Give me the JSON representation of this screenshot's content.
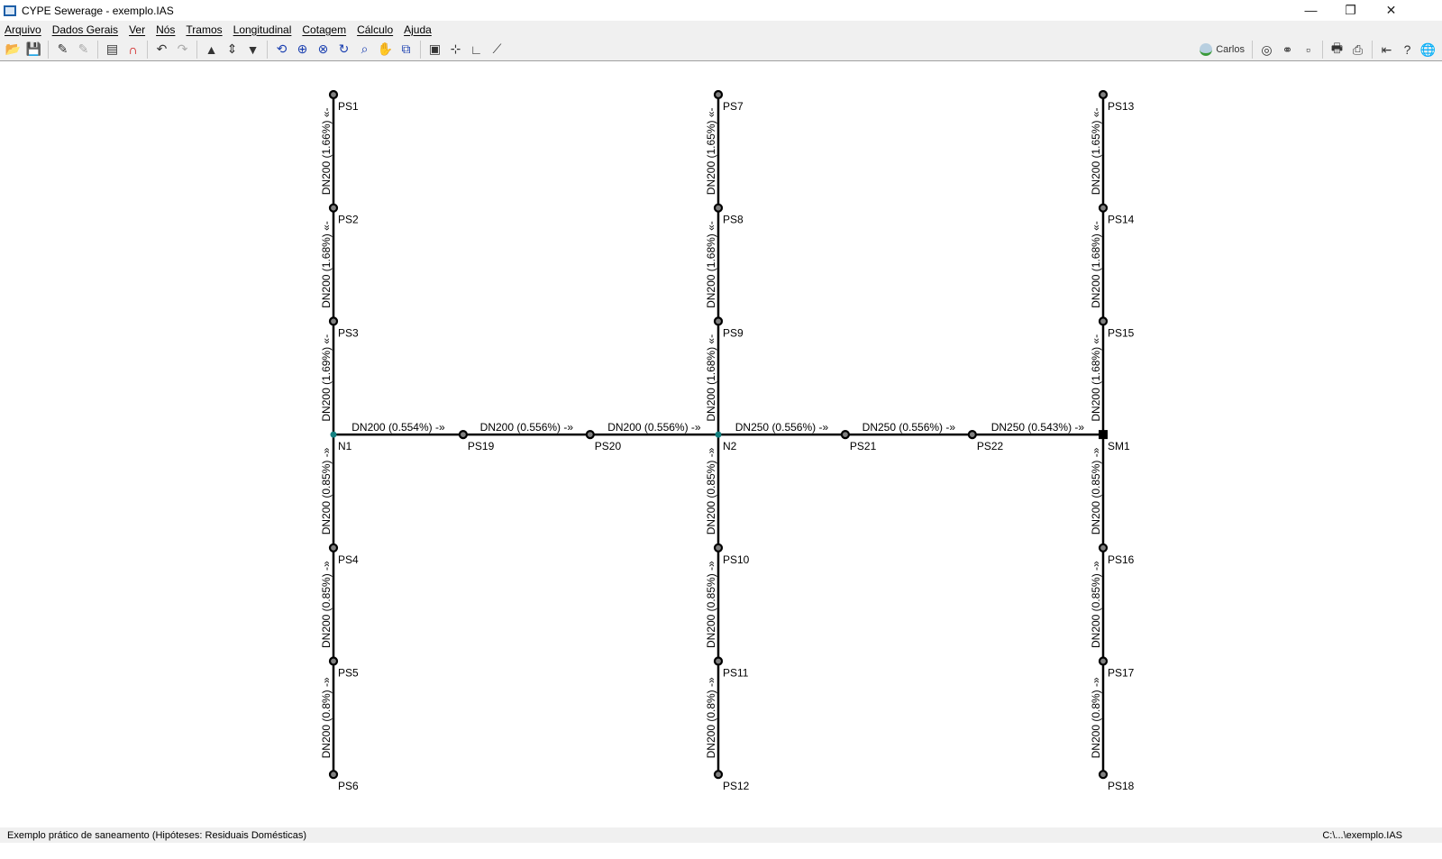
{
  "window": {
    "title": "CYPE Sewerage - exemplo.IAS",
    "minimize": "—",
    "maximize": "❐",
    "close": "✕"
  },
  "menu": [
    "Arquivo",
    "Dados Gerais",
    "Ver",
    "Nós",
    "Tramos",
    "Longitudinal",
    "Cotagem",
    "Cálculo",
    "Ajuda"
  ],
  "toolbar": {
    "left": [
      [
        "open-icon",
        "📂"
      ],
      [
        "save-icon",
        "💾"
      ],
      "|",
      [
        "wizard-icon",
        "✎"
      ],
      [
        "wizard-disabled-icon",
        "✎"
      ],
      "|",
      [
        "dxf-dwg-icon",
        "▤"
      ],
      [
        "magnet-icon",
        "∩"
      ],
      "|",
      [
        "undo-icon",
        "↶"
      ],
      [
        "redo-icon",
        "↷"
      ],
      "|",
      [
        "move-up-icon",
        "▲"
      ],
      [
        "move-updown-icon",
        "⇕"
      ],
      [
        "move-down-icon",
        "▼"
      ],
      "|",
      [
        "zoom-previous-icon",
        "⟲"
      ],
      [
        "zoom-all-icon",
        "⊕"
      ],
      [
        "zoom-x2-icon",
        "⊗"
      ],
      [
        "redraw-icon",
        "↻"
      ],
      [
        "zoom-window-icon",
        "⌕"
      ],
      [
        "pan-hand-icon",
        "✋"
      ],
      [
        "window-icon",
        "⧉"
      ],
      "|",
      [
        "binoculars-icon",
        "▣"
      ],
      [
        "axes-icon",
        "⊹"
      ],
      [
        "angle-icon",
        "∟"
      ],
      [
        "measure-icon",
        "⟋"
      ]
    ],
    "right": [
      [
        "help-green-icon",
        "◎"
      ],
      [
        "share-icon",
        "⚭"
      ],
      [
        "cube-icon",
        "▫"
      ],
      "|",
      [
        "print-icon",
        "🖶"
      ],
      [
        "print-preview-icon",
        "⎙"
      ],
      "|",
      [
        "exit-icon",
        "⇤"
      ],
      [
        "help-icon",
        "?"
      ],
      [
        "web-icon",
        "🌐"
      ]
    ],
    "user": "Carlos"
  },
  "status": {
    "left": "Exemplo prático de saneamento (Hipóteses: Residuais Domésticas)",
    "right": "C:\\...\\exemplo.IAS"
  },
  "network": {
    "nodes": [
      {
        "id": "PS1",
        "col": 0,
        "row": 0
      },
      {
        "id": "PS2",
        "col": 0,
        "row": 1
      },
      {
        "id": "PS3",
        "col": 0,
        "row": 2
      },
      {
        "id": "N1",
        "col": 0,
        "row": 3,
        "type": "junction"
      },
      {
        "id": "PS4",
        "col": 0,
        "row": 4
      },
      {
        "id": "PS5",
        "col": 0,
        "row": 5
      },
      {
        "id": "PS6",
        "col": 0,
        "row": 6
      },
      {
        "id": "PS19",
        "col": 0.337,
        "row": 3
      },
      {
        "id": "PS20",
        "col": 0.667,
        "row": 3
      },
      {
        "id": "PS7",
        "col": 1,
        "row": 0
      },
      {
        "id": "PS8",
        "col": 1,
        "row": 1
      },
      {
        "id": "PS9",
        "col": 1,
        "row": 2
      },
      {
        "id": "N2",
        "col": 1,
        "row": 3,
        "type": "junction"
      },
      {
        "id": "PS10",
        "col": 1,
        "row": 4
      },
      {
        "id": "PS11",
        "col": 1,
        "row": 5
      },
      {
        "id": "PS12",
        "col": 1,
        "row": 6
      },
      {
        "id": "PS21",
        "col": 1.33,
        "row": 3
      },
      {
        "id": "PS22",
        "col": 1.66,
        "row": 3
      },
      {
        "id": "PS13",
        "col": 2,
        "row": 0
      },
      {
        "id": "PS14",
        "col": 2,
        "row": 1
      },
      {
        "id": "PS15",
        "col": 2,
        "row": 2
      },
      {
        "id": "SM1",
        "col": 2,
        "row": 3,
        "type": "outfall"
      },
      {
        "id": "PS16",
        "col": 2,
        "row": 4
      },
      {
        "id": "PS17",
        "col": 2,
        "row": 5
      },
      {
        "id": "PS18",
        "col": 2,
        "row": 6
      }
    ],
    "pipes": [
      {
        "from": "PS1",
        "to": "PS2",
        "label": "DN200 (1.66%) «-"
      },
      {
        "from": "PS2",
        "to": "PS3",
        "label": "DN200 (1.68%) «-"
      },
      {
        "from": "PS3",
        "to": "N1",
        "label": "DN200 (1.69%) «-"
      },
      {
        "from": "N1",
        "to": "PS4",
        "label": "DN200 (0.85%) -»"
      },
      {
        "from": "PS4",
        "to": "PS5",
        "label": "DN200 (0.85%) -»"
      },
      {
        "from": "PS5",
        "to": "PS6",
        "label": "DN200 (0.8%) -»"
      },
      {
        "from": "PS7",
        "to": "PS8",
        "label": "DN200 (1.65%) «-"
      },
      {
        "from": "PS8",
        "to": "PS9",
        "label": "DN200 (1.68%) «-"
      },
      {
        "from": "PS9",
        "to": "N2",
        "label": "DN200 (1.68%) «-"
      },
      {
        "from": "N2",
        "to": "PS10",
        "label": "DN200 (0.85%) -»"
      },
      {
        "from": "PS10",
        "to": "PS11",
        "label": "DN200 (0.85%) -»"
      },
      {
        "from": "PS11",
        "to": "PS12",
        "label": "DN200 (0.8%) -»"
      },
      {
        "from": "PS13",
        "to": "PS14",
        "label": "DN200 (1.65%) «-"
      },
      {
        "from": "PS14",
        "to": "PS15",
        "label": "DN200 (1.68%) «-"
      },
      {
        "from": "PS15",
        "to": "SM1",
        "label": "DN200 (1.68%) «-"
      },
      {
        "from": "SM1",
        "to": "PS16",
        "label": "DN200 (0.85%) -»"
      },
      {
        "from": "PS16",
        "to": "PS17",
        "label": "DN200 (0.85%) -»"
      },
      {
        "from": "PS17",
        "to": "PS18",
        "label": "DN200 (0.8%) -»"
      },
      {
        "from": "N1",
        "to": "PS19",
        "label": "DN200 (0.554%) -»"
      },
      {
        "from": "PS19",
        "to": "PS20",
        "label": "DN200 (0.556%) -»"
      },
      {
        "from": "PS20",
        "to": "N2",
        "label": "DN200 (0.556%) -»"
      },
      {
        "from": "N2",
        "to": "PS21",
        "label": "DN250 (0.556%) -»"
      },
      {
        "from": "PS21",
        "to": "PS22",
        "label": "DN250 (0.556%) -»"
      },
      {
        "from": "PS22",
        "to": "SM1",
        "label": "DN250 (0.543%) -»"
      }
    ],
    "colors": {
      "junction": "#138080",
      "node": "#808080",
      "line": "#000000"
    }
  }
}
